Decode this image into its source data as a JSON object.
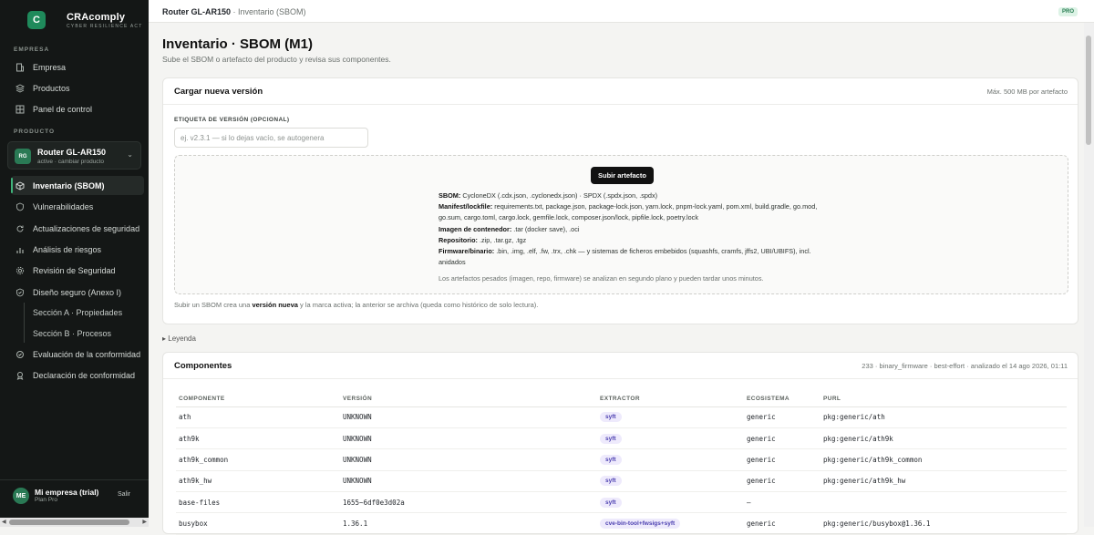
{
  "brand": {
    "logo": "C",
    "name": "CRAcomply",
    "tagline": "CYBER RESILIENCE ACT"
  },
  "sidebar": {
    "section_company": "EMPRESA",
    "company_items": [
      {
        "label": "Empresa",
        "icon": "building-icon"
      },
      {
        "label": "Productos",
        "icon": "layers-icon"
      },
      {
        "label": "Panel de control",
        "icon": "dashboard-icon"
      }
    ],
    "section_product": "PRODUCTO",
    "product": {
      "badge": "RG",
      "name": "Router GL-AR150",
      "status": "active · cambiar producto"
    },
    "product_items": [
      {
        "label": "Inventario (SBOM)",
        "icon": "cube-icon",
        "active": true
      },
      {
        "label": "Vulnerabilidades",
        "icon": "shield-icon"
      },
      {
        "label": "Actualizaciones de seguridad",
        "icon": "refresh-icon"
      },
      {
        "label": "Análisis de riesgos",
        "icon": "bar-chart-icon"
      },
      {
        "label": "Revisión de Seguridad",
        "icon": "gear-icon"
      },
      {
        "label": "Diseño seguro (Anexo I)",
        "icon": "shield-check-icon"
      },
      {
        "label": "Evaluación de la conformidad",
        "icon": "badge-icon"
      },
      {
        "label": "Declaración de conformidad",
        "icon": "ribbon-icon"
      }
    ],
    "sub_items": [
      "Sección A · Propiedades",
      "Sección B · Procesos"
    ],
    "user": {
      "initials": "ME",
      "name": "Mi empresa (trial)",
      "plan": "Plan Pro",
      "logout": "Salir"
    }
  },
  "topbar": {
    "product": "Router GL-AR150",
    "separator": " · ",
    "page": "Inventario (SBOM)",
    "badge": "PRO"
  },
  "header": {
    "title": "Inventario · SBOM (M1)",
    "subtitle": "Sube el SBOM o artefacto del producto y revisa sus componentes."
  },
  "upload_card": {
    "title": "Cargar nueva versión",
    "max_size": "Máx. 500 MB por artefacto",
    "version_label": "ETIQUETA DE VERSIÓN (OPCIONAL)",
    "version_placeholder": "ej. v2.3.1 — si lo dejas vacío, se autogenera",
    "button": "Subir artefacto",
    "formats": [
      {
        "label": "SBOM:",
        "text": " CycloneDX (.cdx.json, .cyclonedx.json) · SPDX (.spdx.json, .spdx)"
      },
      {
        "label": "Manifest/lockfile:",
        "text": " requirements.txt, package.json, package-lock.json, yarn.lock, pnpm-lock.yaml, pom.xml, build.gradle, go.mod, go.sum, cargo.toml, cargo.lock, gemfile.lock, composer.json/lock, pipfile.lock, poetry.lock"
      },
      {
        "label": "Imagen de contenedor:",
        "text": " .tar (docker save), .oci"
      },
      {
        "label": "Repositorio:",
        "text": " .zip, .tar.gz, .tgz"
      },
      {
        "label": "Firmware/binario:",
        "text": " .bin, .img, .elf, .fw, .trx, .chk — y sistemas de ficheros embebidos (squashfs, cramfs, jffs2, UBI/UBIFS), incl. anidados"
      }
    ],
    "note": "Los artefactos pesados (imagen, repo, firmware) se analizan en segundo plano y pueden tardar unos minutos.",
    "hint_before": "Subir un SBOM crea una ",
    "hint_bold": "versión nueva",
    "hint_after": " y la marca activa; la anterior se archiva (queda como histórico de solo lectura)."
  },
  "legend_toggle": "▸ Leyenda",
  "components_card": {
    "title": "Componentes",
    "meta": "233 · binary_firmware · best-effort · analizado el 14 ago 2026, 01:11",
    "columns": [
      "COMPONENTE",
      "VERSIÓN",
      "EXTRACTOR",
      "ECOSISTEMA",
      "PURL"
    ],
    "rows": [
      {
        "name": "ath",
        "version": "UNKNOWN",
        "extractor": "syft",
        "ecosystem": "generic",
        "purl": "pkg:generic/ath"
      },
      {
        "name": "ath9k",
        "version": "UNKNOWN",
        "extractor": "syft",
        "ecosystem": "generic",
        "purl": "pkg:generic/ath9k"
      },
      {
        "name": "ath9k_common",
        "version": "UNKNOWN",
        "extractor": "syft",
        "ecosystem": "generic",
        "purl": "pkg:generic/ath9k_common"
      },
      {
        "name": "ath9k_hw",
        "version": "UNKNOWN",
        "extractor": "syft",
        "ecosystem": "generic",
        "purl": "pkg:generic/ath9k_hw"
      },
      {
        "name": "base-files",
        "version": "1655~6df0e3d02a",
        "extractor": "syft",
        "ecosystem": "—",
        "purl": ""
      },
      {
        "name": "busybox",
        "version": "1.36.1",
        "extractor": "cve-bin-tool+fwsigs+syft",
        "ecosystem": "generic",
        "purl": "pkg:generic/busybox@1.36.1"
      }
    ]
  },
  "colors": {
    "accent": "#1f8a5b",
    "sidebar_bg": "#141716",
    "pill_bg": "#eeeafc",
    "pill_text": "#4b3fb0"
  }
}
